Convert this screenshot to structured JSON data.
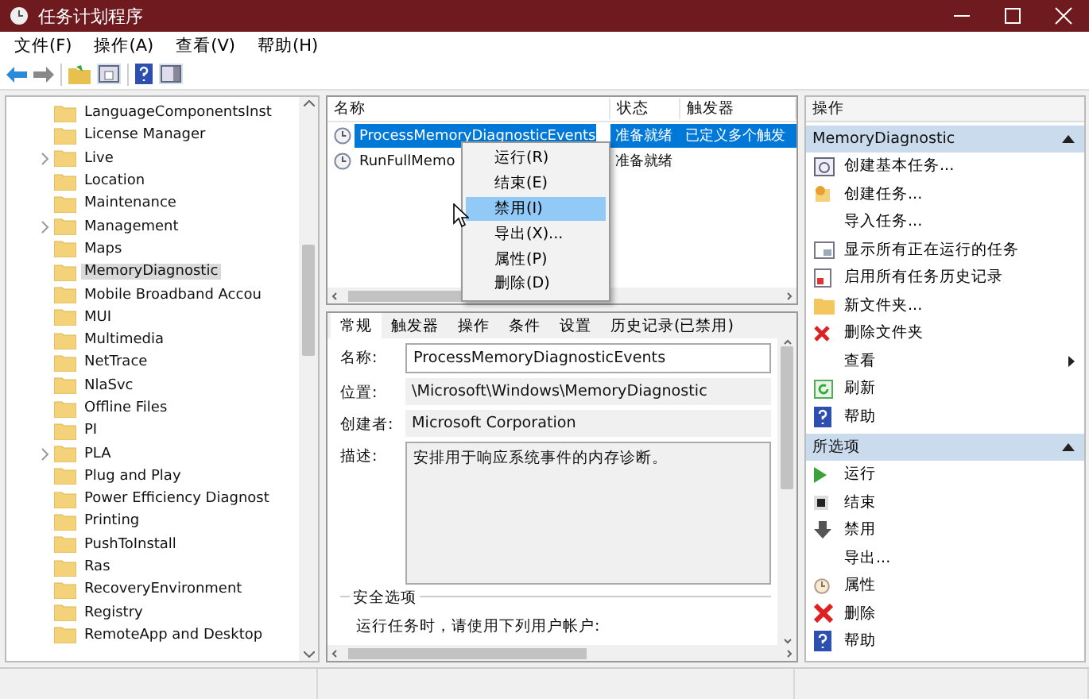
{
  "window": {
    "title": "任务计划程序"
  },
  "menu": [
    "文件(F)",
    "操作(A)",
    "查看(V)",
    "帮助(H)"
  ],
  "tree": {
    "items": [
      {
        "label": "LanguageComponentsInst",
        "expandable": false,
        "selected": false
      },
      {
        "label": "License Manager",
        "expandable": false,
        "selected": false
      },
      {
        "label": "Live",
        "expandable": true,
        "selected": false
      },
      {
        "label": "Location",
        "expandable": false,
        "selected": false
      },
      {
        "label": "Maintenance",
        "expandable": false,
        "selected": false
      },
      {
        "label": "Management",
        "expandable": true,
        "selected": false
      },
      {
        "label": "Maps",
        "expandable": false,
        "selected": false
      },
      {
        "label": "MemoryDiagnostic",
        "expandable": false,
        "selected": true
      },
      {
        "label": "Mobile Broadband Accou",
        "expandable": false,
        "selected": false
      },
      {
        "label": "MUI",
        "expandable": false,
        "selected": false
      },
      {
        "label": "Multimedia",
        "expandable": false,
        "selected": false
      },
      {
        "label": "NetTrace",
        "expandable": false,
        "selected": false
      },
      {
        "label": "NlaSvc",
        "expandable": false,
        "selected": false
      },
      {
        "label": "Offline Files",
        "expandable": false,
        "selected": false
      },
      {
        "label": "PI",
        "expandable": false,
        "selected": false
      },
      {
        "label": "PLA",
        "expandable": true,
        "selected": false
      },
      {
        "label": "Plug and Play",
        "expandable": false,
        "selected": false
      },
      {
        "label": "Power Efficiency Diagnost",
        "expandable": false,
        "selected": false
      },
      {
        "label": "Printing",
        "expandable": false,
        "selected": false
      },
      {
        "label": "PushToInstall",
        "expandable": false,
        "selected": false
      },
      {
        "label": "Ras",
        "expandable": false,
        "selected": false
      },
      {
        "label": "RecoveryEnvironment",
        "expandable": false,
        "selected": false
      },
      {
        "label": "Registry",
        "expandable": false,
        "selected": false
      },
      {
        "label": "RemoteApp and Desktop",
        "expandable": false,
        "selected": false
      }
    ]
  },
  "tasks": {
    "columns": [
      "名称",
      "状态",
      "触发器"
    ],
    "rows": [
      {
        "name": "ProcessMemoryDiagnosticEvents",
        "status": "准备就绪",
        "trigger": "已定义多个触发",
        "selected": true
      },
      {
        "name": "RunFullMemo",
        "status": "准备就绪",
        "trigger": "",
        "selected": false
      }
    ]
  },
  "context_menu": [
    {
      "label": "运行(R)",
      "selected": false
    },
    {
      "label": "结束(E)",
      "selected": false
    },
    {
      "label": "禁用(I)",
      "selected": true
    },
    {
      "label": "导出(X)...",
      "selected": false
    },
    {
      "label": "属性(P)",
      "selected": false
    },
    {
      "label": "删除(D)",
      "selected": false
    }
  ],
  "details": {
    "tabs": [
      {
        "label": "常规",
        "selected": true
      },
      {
        "label": "触发器",
        "selected": false
      },
      {
        "label": "操作",
        "selected": false
      },
      {
        "label": "条件",
        "selected": false
      },
      {
        "label": "设置",
        "selected": false
      },
      {
        "label": "历史记录(已禁用)",
        "selected": false
      }
    ],
    "fields": [
      {
        "label": "名称:",
        "value": "ProcessMemoryDiagnosticEvents",
        "kind": "input"
      },
      {
        "label": "位置:",
        "value": "\\Microsoft\\Windows\\MemoryDiagnostic",
        "kind": "text"
      },
      {
        "label": "创建者:",
        "value": "Microsoft Corporation",
        "kind": "text"
      },
      {
        "label": "描述:",
        "value": "安排用于响应系统事件的内存诊断。",
        "kind": "area"
      }
    ],
    "security_title": "安全选项",
    "security_text": "运行任务时，请使用下列用户帐户:"
  },
  "actions": {
    "title": "操作",
    "groups": [
      {
        "title": "MemoryDiagnostic",
        "expanded": true,
        "items": [
          "创建基本任务...",
          "创建任务...",
          "导入任务...",
          "显示所有正在运行的任务",
          "启用所有任务历史记录",
          "新文件夹...",
          "删除文件夹",
          "查看",
          "刷新",
          "帮助"
        ]
      },
      {
        "title": "所选项",
        "expanded": true,
        "items": [
          "运行",
          "结束",
          "禁用",
          "导出...",
          "属性",
          "删除",
          "帮助"
        ]
      }
    ]
  }
}
